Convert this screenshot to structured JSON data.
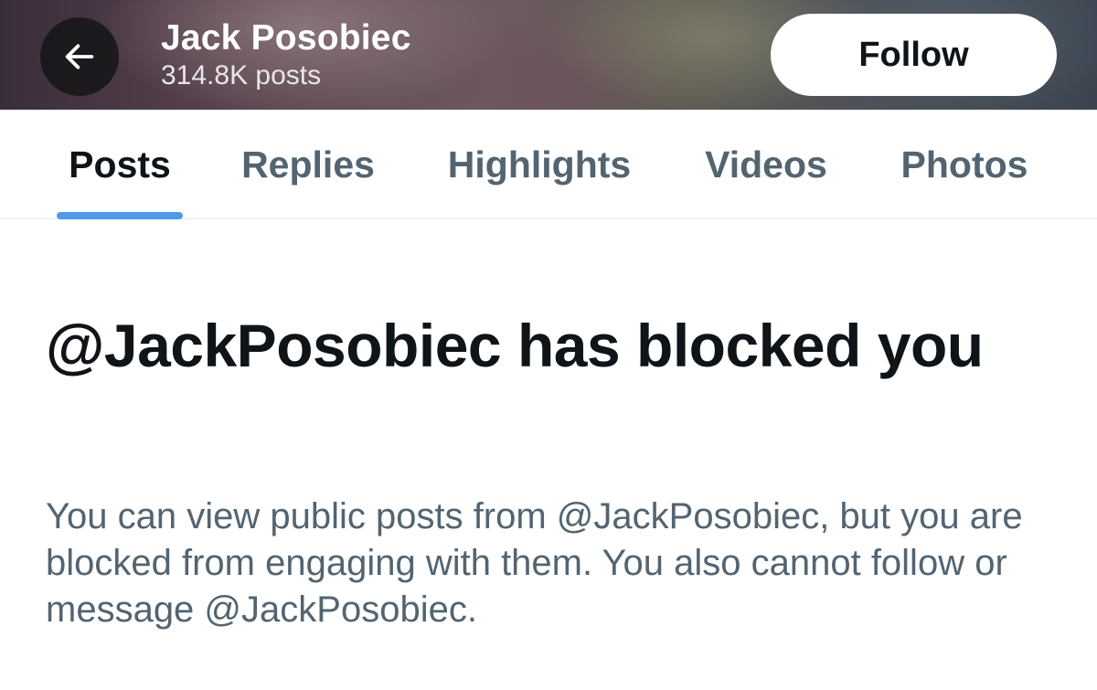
{
  "header": {
    "back_icon": "arrow-left-icon",
    "profile_name": "Jack Posobiec",
    "post_count": "314.8K posts",
    "follow_label": "Follow"
  },
  "tabs": [
    {
      "label": "Posts",
      "active": true
    },
    {
      "label": "Replies",
      "active": false
    },
    {
      "label": "Highlights",
      "active": false
    },
    {
      "label": "Videos",
      "active": false
    },
    {
      "label": "Photos",
      "active": false
    }
  ],
  "blocked": {
    "title": "@JackPosobiec has blocked you",
    "description": "You can view public posts from @JackPosobiec, but you are blocked from engaging with them. You also cannot follow or message @JackPosobiec."
  },
  "colors": {
    "accent": "#4f99e6",
    "primary_text": "#0f1419",
    "secondary_text": "#536471"
  }
}
